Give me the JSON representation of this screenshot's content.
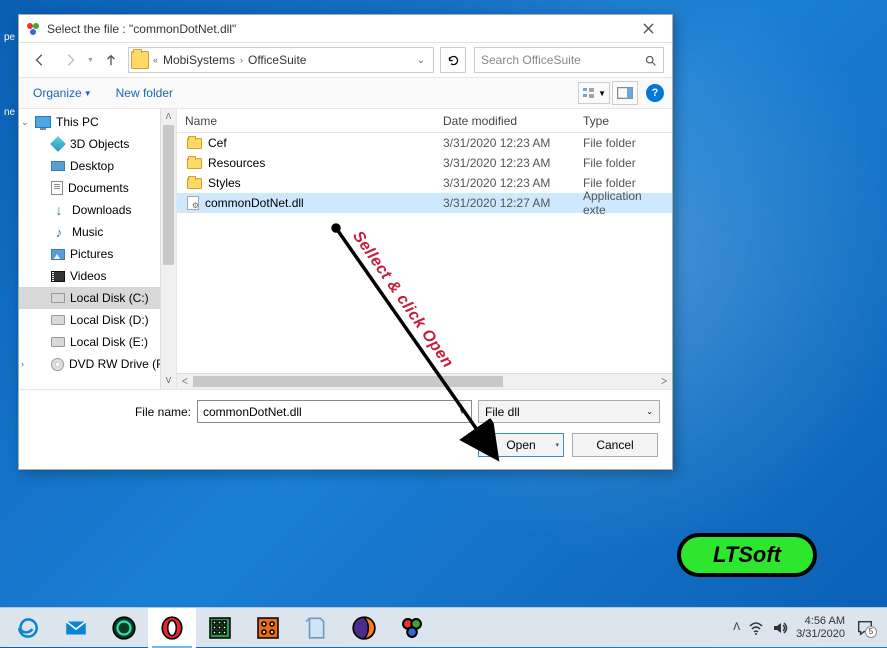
{
  "dialog": {
    "title": "Select the file : \"commonDotNet.dll\"",
    "breadcrumb": {
      "prefix": "«",
      "p1": "MobiSystems",
      "p2": "OfficeSuite"
    },
    "search_placeholder": "Search OfficeSuite",
    "toolbar": {
      "organize": "Organize",
      "newfolder": "New folder"
    },
    "columns": {
      "name": "Name",
      "date": "Date modified",
      "type": "Type"
    },
    "tree": {
      "thispc": "This PC",
      "objects3d": "3D Objects",
      "desktop": "Desktop",
      "documents": "Documents",
      "downloads": "Downloads",
      "music": "Music",
      "pictures": "Pictures",
      "videos": "Videos",
      "diskc": "Local Disk (C:)",
      "diskd": "Local Disk (D:)",
      "diske": "Local Disk (E:)",
      "dvd": "DVD RW Drive (F"
    },
    "rows": [
      {
        "name": "Cef",
        "date": "3/31/2020 12:23 AM",
        "type": "File folder",
        "icon": "folder"
      },
      {
        "name": "Resources",
        "date": "3/31/2020 12:23 AM",
        "type": "File folder",
        "icon": "folder"
      },
      {
        "name": "Styles",
        "date": "3/31/2020 12:23 AM",
        "type": "File folder",
        "icon": "folder"
      },
      {
        "name": "commonDotNet.dll",
        "date": "3/31/2020 12:27 AM",
        "type": "Application exte",
        "icon": "dll",
        "selected": true
      }
    ],
    "filename_label": "File name:",
    "filename_value": "commonDotNet.dll",
    "filter": "File dll",
    "open": "Open",
    "cancel": "Cancel"
  },
  "annotation": "Sellect & click Open",
  "ltsoft": "LTSoft",
  "bg": {
    "i1": "pe",
    "i2": "ne"
  },
  "taskbar": {
    "time": "4:56 AM",
    "date": "3/31/2020",
    "notif_count": "5"
  }
}
